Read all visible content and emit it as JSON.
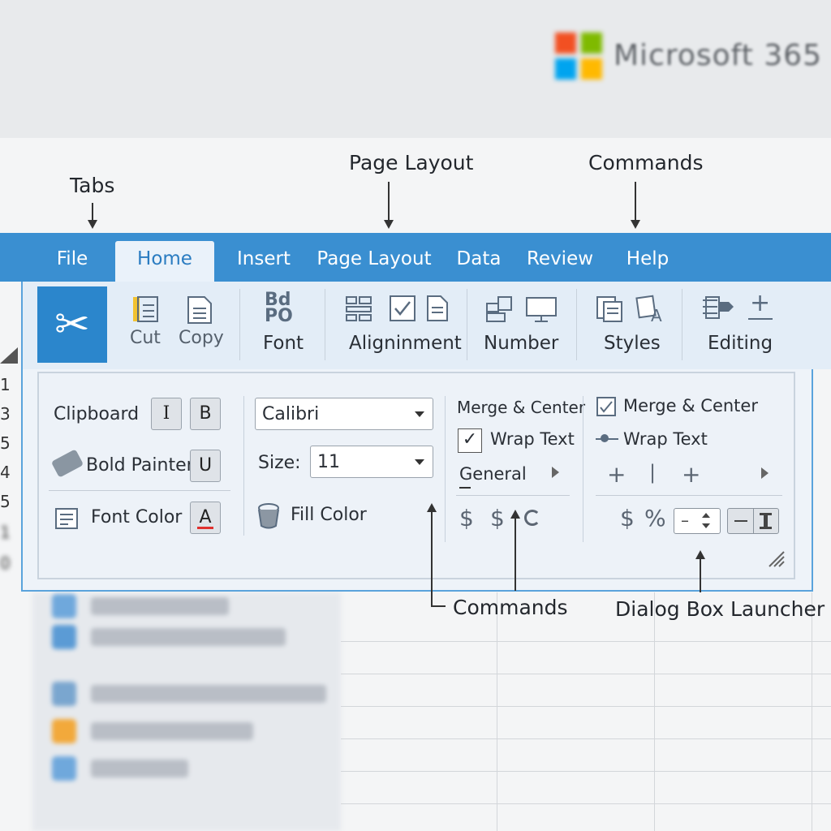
{
  "brand": {
    "name": "Microsoft 365",
    "colors": {
      "red": "#f25022",
      "green": "#7fba00",
      "blue": "#00a4ef",
      "yellow": "#ffb900"
    }
  },
  "annotations": {
    "tabs": "Tabs",
    "page_layout": "Page Layout",
    "commands_top": "Commands",
    "commands_bottom": "Commands",
    "dialog_box_launcher": "Dialog Box Launcher"
  },
  "tabs": [
    "File",
    "Home",
    "Insert",
    "Page Layout",
    "Data",
    "Review",
    "Help"
  ],
  "active_tab": "Home",
  "ribbon": {
    "clipboard_icon": "scissors-icon",
    "cut": "Cut",
    "copy": "Copy",
    "font": "Font",
    "alignment": "Aligninment",
    "number": "Number",
    "styles": "Styles",
    "editing": "Editing"
  },
  "panel": {
    "clipboard": "Clipboard",
    "italic": "I",
    "bold": "B",
    "bold_painter": "Bold Painter",
    "underline": "U",
    "font_color": "Font Color",
    "font_color_btn": "A",
    "font_name": "Calibri",
    "size_label": "Size:",
    "size_value": "11",
    "fill_color": "Fill Color",
    "merge_center_1": "Merge & Center",
    "wrap_text_1": "Wrap Text",
    "general": "General",
    "merge_center_2": "Merge & Center",
    "wrap_text_2": "Wrap Text",
    "plus": "+",
    "bar": "|",
    "dollar": "$",
    "percent": "%",
    "minus": "–"
  },
  "row_numbers": [
    "1",
    "3",
    "5",
    "4",
    "5",
    "1",
    "0"
  ],
  "accent_color": "#3a8fd1"
}
